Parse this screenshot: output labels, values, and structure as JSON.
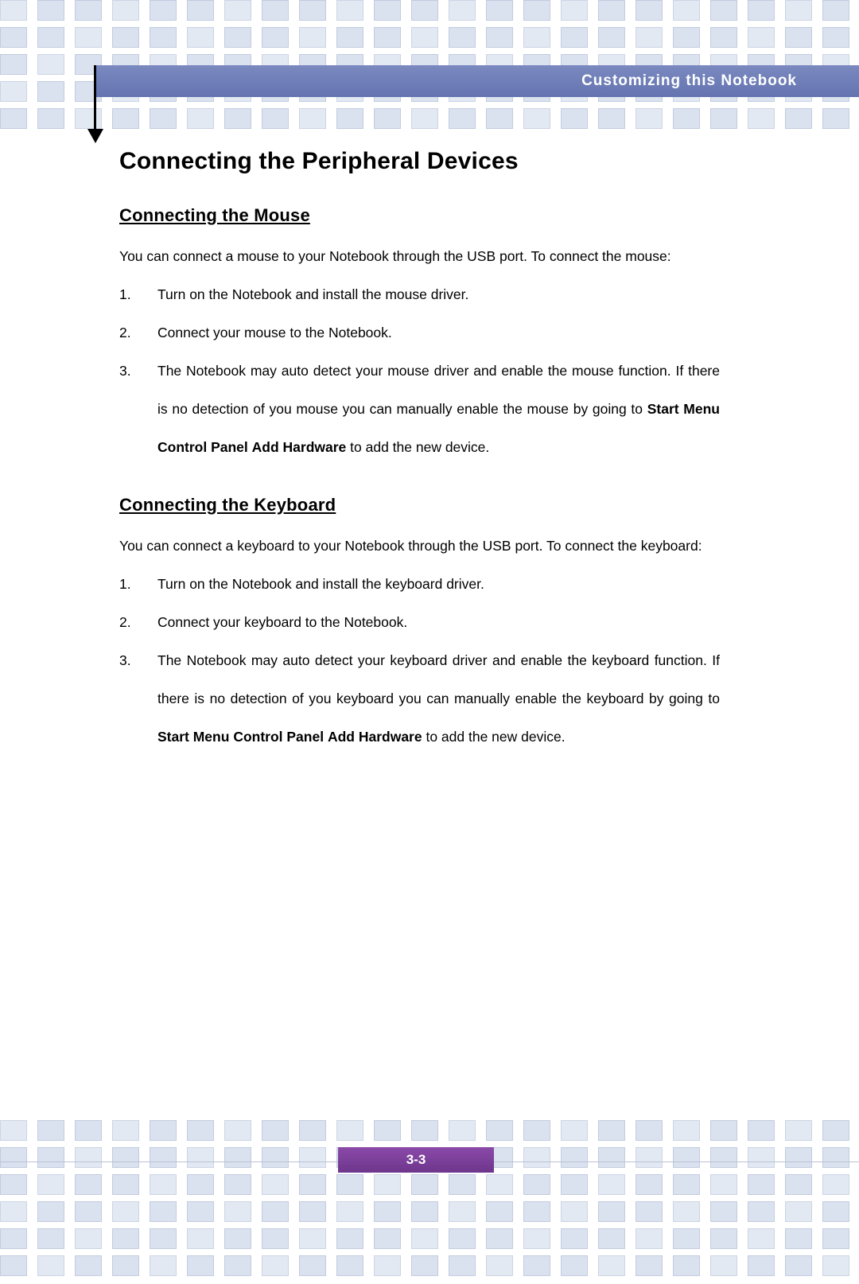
{
  "header": {
    "running_title": "Customizing this Notebook"
  },
  "page": {
    "title": "Connecting the Peripheral Devices",
    "number": "3-3"
  },
  "sections": [
    {
      "heading": "Connecting the Mouse",
      "intro": "You can connect a mouse to your Notebook through the USB port. To connect the mouse:",
      "steps": [
        {
          "num": "1.",
          "parts": [
            {
              "text": "Turn on the Notebook and install the mouse driver.",
              "bold": false
            }
          ]
        },
        {
          "num": "2.",
          "parts": [
            {
              "text": "Connect your mouse to the Notebook.",
              "bold": false
            }
          ]
        },
        {
          "num": "3.",
          "parts": [
            {
              "text": "The Notebook may auto detect your mouse driver and enable the mouse function.  If there is no detection of you mouse you can manually enable the mouse by going to ",
              "bold": false
            },
            {
              "text": "Start Menu",
              "bold": true
            },
            {
              "text": "     ",
              "bold": false
            },
            {
              "text": "Control Panel",
              "bold": true
            },
            {
              "text": "     ",
              "bold": false
            },
            {
              "text": "Add Hardware",
              "bold": true
            },
            {
              "text": " to add the new device.",
              "bold": false
            }
          ]
        }
      ]
    },
    {
      "heading": "Connecting the Keyboard",
      "intro": "You can connect a keyboard to your Notebook through the USB port. To connect the keyboard:",
      "steps": [
        {
          "num": "1.",
          "parts": [
            {
              "text": "Turn on the Notebook and install the keyboard driver.",
              "bold": false
            }
          ]
        },
        {
          "num": "2.",
          "parts": [
            {
              "text": "Connect your keyboard to the Notebook.",
              "bold": false
            }
          ]
        },
        {
          "num": "3.",
          "parts": [
            {
              "text": "The Notebook may auto detect your keyboard driver and enable the keyboard function.  If there is no detection of you keyboard you can manually enable the keyboard by going to ",
              "bold": false
            },
            {
              "text": "Start Menu",
              "bold": true
            },
            {
              "text": "     ",
              "bold": false
            },
            {
              "text": "Control Panel",
              "bold": true
            },
            {
              "text": "     ",
              "bold": false
            },
            {
              "text": "Add Hardware",
              "bold": true
            },
            {
              "text": " to add the new device.",
              "bold": false
            }
          ]
        }
      ]
    }
  ],
  "colors": {
    "header_bar": "#6b7bb5",
    "page_tab": "#7b3f99",
    "decor_square": "#dbe2ef"
  }
}
